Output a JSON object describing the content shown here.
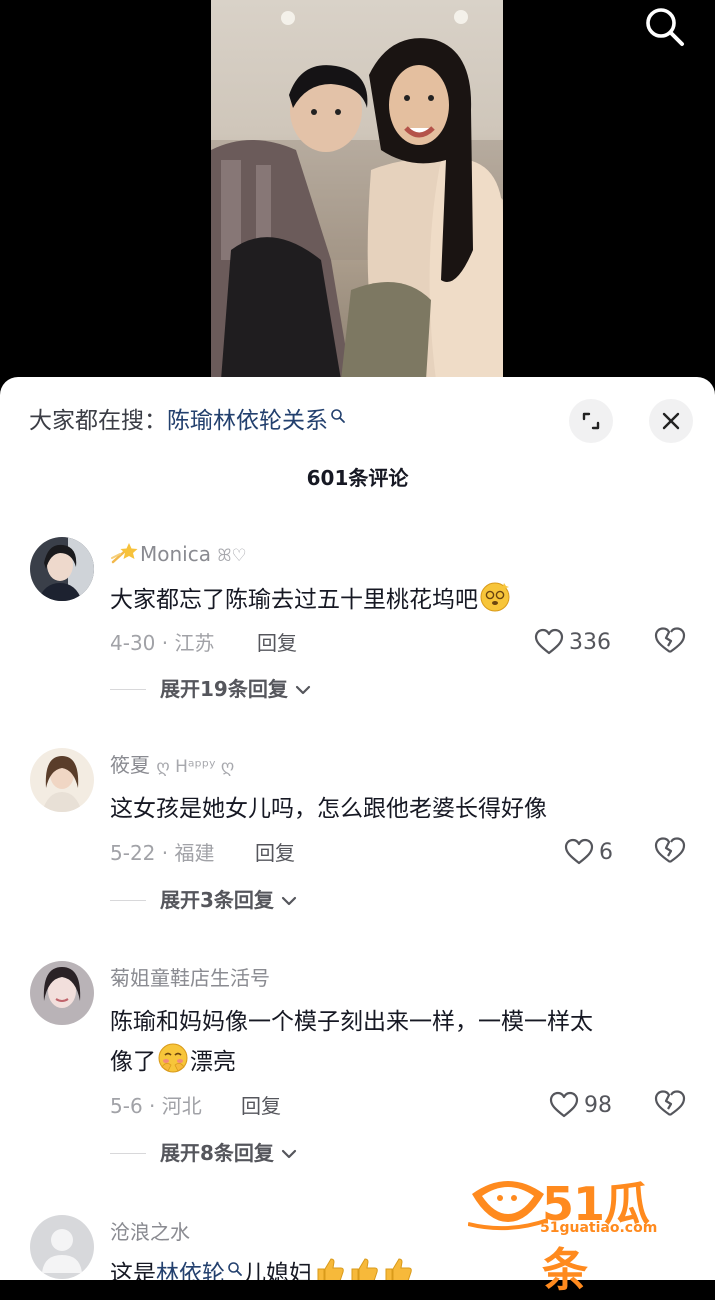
{
  "header": {
    "hot_search_prefix": "大家都在搜：",
    "hot_search_term": "陈瑜林依轮关系",
    "comment_count": "601条评论"
  },
  "comments": [
    {
      "username": "Monica",
      "username_deco": "ꕤ♡",
      "text": "大家都忘了陈瑜去过五十里桃花坞吧",
      "date_location": "4-30 · 江苏",
      "reply_label": "回复",
      "likes": "336",
      "expand_label": "展开19条回复"
    },
    {
      "username": "筱夏",
      "username_deco": "ღ Hᵃᵖᵖʸ ღ",
      "text": "这女孩是她女儿吗，怎么跟他老婆长得好像",
      "date_location": "5-22 · 福建",
      "reply_label": "回复",
      "likes": "6",
      "expand_label": "展开3条回复"
    },
    {
      "username": "菊姐童鞋店生活号",
      "username_deco": "",
      "text_line1": "陈瑜和妈妈像一个模子刻出来一样，一模一样太",
      "text_line2_a": "像了",
      "text_line2_b": "漂亮",
      "date_location": "5-6 · 河北",
      "reply_label": "回复",
      "likes": "98",
      "expand_label": "展开8条回复"
    },
    {
      "username": "沧浪之水",
      "username_deco": "",
      "text_a": "这是",
      "text_link": "林依轮",
      "text_b": "儿媳妇"
    }
  ],
  "watermark": {
    "text": "51瓜条",
    "sub": "51guatiao.com"
  },
  "icons": {
    "search": "search-icon",
    "expand": "expand-icon",
    "close": "close-icon",
    "like": "heart-outline-icon",
    "dislike": "broken-heart-icon",
    "chevron": "chevron-down-icon"
  },
  "colors": {
    "link": "#23406e",
    "meta": "#a1a2a7",
    "watermark": "#ff8a1e"
  }
}
